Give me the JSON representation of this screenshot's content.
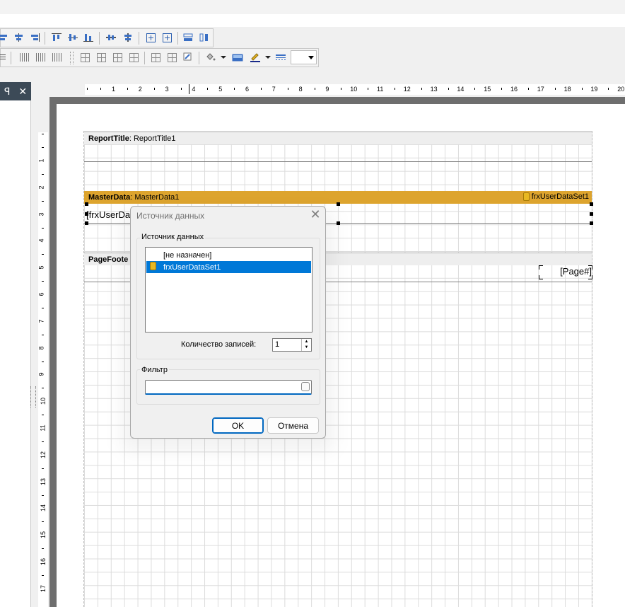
{
  "colors": {
    "master_band": "#dda42e",
    "selection": "#0078d7",
    "pane_header": "#3c4a57",
    "focus_border": "#0067c0"
  },
  "toolbar_row1_icons": [
    "align-left-icon",
    "align-center-icon",
    "align-right-icon",
    "align-top-icon",
    "align-middle-icon",
    "align-bottom-icon",
    "center-horizontally-icon",
    "center-vertically-icon",
    "center-in-band-horizontal-icon",
    "center-in-band-vertical-icon",
    "same-width-icon",
    "same-height-icon"
  ],
  "toolbar_row2_icons": [
    "justify-icon",
    "space-horizontal-icon",
    "space-horizontal-dec-icon",
    "space-horizontal-inc-icon",
    "frame-all-icon",
    "frame-top-icon",
    "frame-bottom-icon",
    "frame-left-icon",
    "frame-none-icon",
    "frame-right-icon",
    "frame-shadow-icon",
    "fill-color-icon",
    "fill-style-icon",
    "line-color-icon",
    "line-style-icon"
  ],
  "left_pane": {
    "pin_glyph": "ꟼ",
    "close_glyph": "✕"
  },
  "ruler": {
    "h_numbers": [
      "1",
      "2",
      "3",
      "4",
      "5",
      "6",
      "7",
      "8",
      "9",
      "10",
      "11",
      "12",
      "13",
      "14",
      "15",
      "16",
      "17",
      "18",
      "19",
      "20"
    ],
    "v_numbers": [
      "1",
      "2",
      "3",
      "4",
      "5",
      "6",
      "7",
      "8",
      "9",
      "10",
      "11",
      "12",
      "13",
      "14",
      "15",
      "16",
      "17"
    ]
  },
  "bands": {
    "report_title": {
      "type": "ReportTitle",
      "name": ": ReportTitle1"
    },
    "master_data": {
      "type": "MasterData",
      "name": ": MasterData1",
      "dataset": "frxUserDataSet1"
    },
    "page_footer": {
      "type": "PageFoote"
    }
  },
  "objects": {
    "memo_text": "[frxUserDa",
    "page_number": "[Page#]"
  },
  "dialog": {
    "title": "Источник данных",
    "close_glyph": "✕",
    "group_source_label": "Источник данных",
    "list_items": [
      {
        "label": "[не назначен]",
        "selected": false
      },
      {
        "label": "frxUserDataSet1",
        "selected": true
      }
    ],
    "records_label": "Количество записей:",
    "records_value": "1",
    "filter_label": "Фильтр",
    "filter_value": "",
    "ok_label": "OK",
    "cancel_label": "Отмена"
  }
}
